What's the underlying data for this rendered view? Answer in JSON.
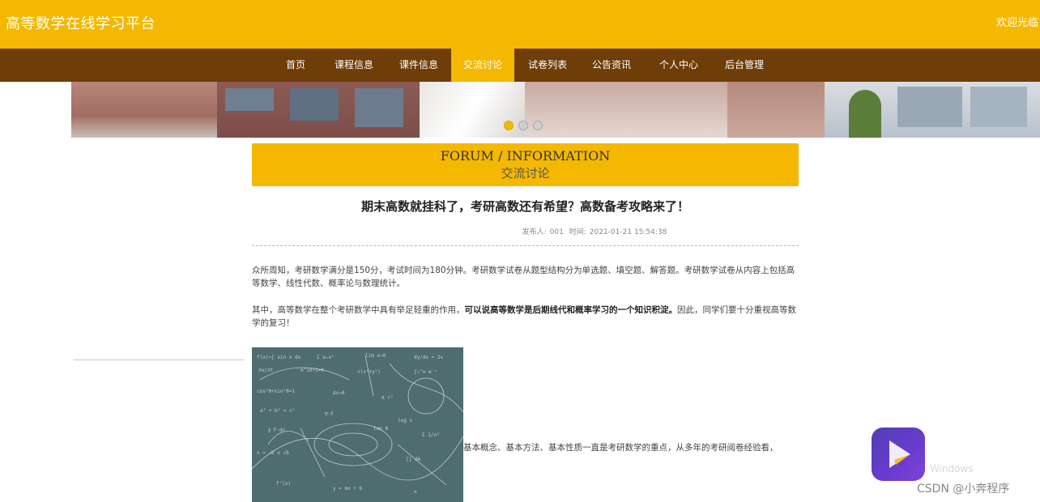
{
  "topbar": {
    "site_title": "高等数学在线学习平台",
    "welcome": "欢迎光临"
  },
  "nav": {
    "items": [
      {
        "label": "首页",
        "active": false
      },
      {
        "label": "课程信息",
        "active": false
      },
      {
        "label": "课件信息",
        "active": false
      },
      {
        "label": "交流讨论",
        "active": true
      },
      {
        "label": "试卷列表",
        "active": false
      },
      {
        "label": "公告资讯",
        "active": false
      },
      {
        "label": "个人中心",
        "active": false
      },
      {
        "label": "后台管理",
        "active": false
      }
    ]
  },
  "banner": {
    "slide_count": 3,
    "active_slide": 1
  },
  "section_header": {
    "en": "FORUM / INFORMATION",
    "cn": "交流讨论"
  },
  "article": {
    "title": "期末高数就挂科了，考研高数还有希望？高数备考攻略来了！",
    "publisher_label": "发布人:",
    "publisher": "001",
    "time_label": "时间:",
    "time": "2021-01-21 15:54:38",
    "paragraph_1": "众所周知，考研数学满分是150分，考试时间为180分钟。考研数学试卷从题型结构分为单选题、填空题、解答题。考研数学试卷从内容上包括高等数学、线性代数、概率论与数理统计。",
    "paragraph_2_normal": "其中，高等数学在整个考研数学中具有举足轻重的作用，",
    "paragraph_2_bold": "可以说高等数学是后期线代和概率学习的一个知识积淀。",
    "paragraph_2_tail": "因此，同学们要十分重视高等数学的复习！",
    "paragraph_3": "基本概念、基本方法、基本性质一直是考研数学的重点，从多年的考研阅卷经验看，"
  },
  "overlay": {
    "windows_text": "Windows",
    "watermark": "CSDN @小奔程序"
  },
  "colors": {
    "accent": "#f4b800",
    "nav_bg": "#6e3d08"
  }
}
